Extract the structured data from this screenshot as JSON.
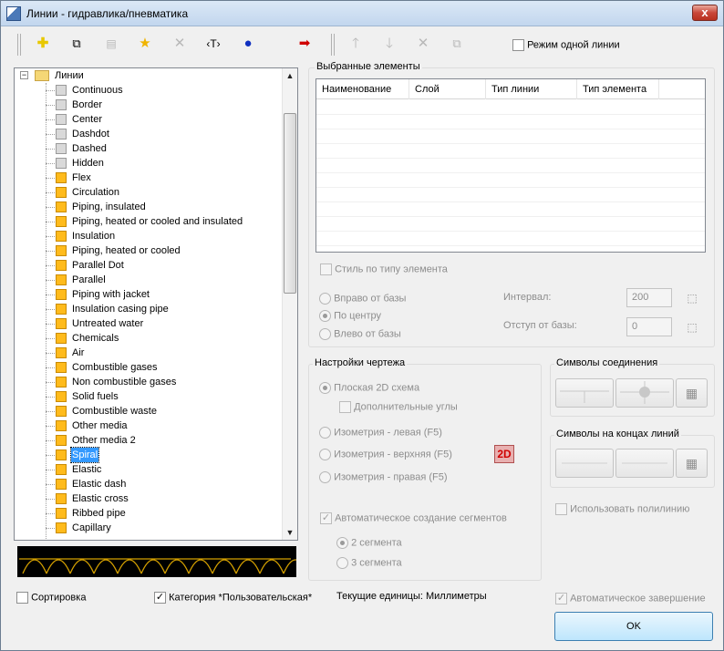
{
  "window": {
    "title": "Линии - гидравлика/пневматика",
    "close_label": "x"
  },
  "toolbar": {
    "mode_label": "Режим одной линии"
  },
  "tree": {
    "root": "Линии",
    "items": [
      {
        "label": "Continuous",
        "color": "gray"
      },
      {
        "label": "Border",
        "color": "gray"
      },
      {
        "label": "Center",
        "color": "gray"
      },
      {
        "label": "Dashdot",
        "color": "gray"
      },
      {
        "label": "Dashed",
        "color": "gray"
      },
      {
        "label": "Hidden",
        "color": "gray"
      },
      {
        "label": "Flex",
        "color": "orange"
      },
      {
        "label": "Circulation",
        "color": "orange"
      },
      {
        "label": "Piping, insulated",
        "color": "orange"
      },
      {
        "label": "Piping, heated or cooled and insulated",
        "color": "orange"
      },
      {
        "label": "Insulation",
        "color": "orange"
      },
      {
        "label": "Piping, heated or cooled",
        "color": "orange"
      },
      {
        "label": "Parallel Dot",
        "color": "orange"
      },
      {
        "label": "Parallel",
        "color": "orange"
      },
      {
        "label": "Piping with jacket",
        "color": "orange"
      },
      {
        "label": "Insulation casing pipe",
        "color": "orange"
      },
      {
        "label": "Untreated water",
        "color": "orange"
      },
      {
        "label": "Chemicals",
        "color": "orange"
      },
      {
        "label": "Air",
        "color": "orange"
      },
      {
        "label": "Combustible gases",
        "color": "orange"
      },
      {
        "label": "Non combustible gases",
        "color": "orange"
      },
      {
        "label": "Solid fuels",
        "color": "orange"
      },
      {
        "label": "Combustible waste",
        "color": "orange"
      },
      {
        "label": "Other media",
        "color": "orange"
      },
      {
        "label": "Other media 2",
        "color": "orange"
      },
      {
        "label": "Spiral",
        "color": "orange",
        "selected": true
      },
      {
        "label": "Elastic",
        "color": "orange"
      },
      {
        "label": "Elastic dash",
        "color": "orange"
      },
      {
        "label": "Elastic cross",
        "color": "orange"
      },
      {
        "label": "Ribbed pipe",
        "color": "orange"
      },
      {
        "label": "Capillary",
        "color": "orange"
      }
    ]
  },
  "selected_group": {
    "title": "Выбранные элементы",
    "columns": [
      "Наименование",
      "Слой",
      "Тип линии",
      "Тип элемента"
    ],
    "style_by_type": "Стиль по типу элемента",
    "align_right": "Вправо от базы",
    "align_center": "По центру",
    "align_left": "Влево от базы",
    "interval_label": "Интервал:",
    "interval_value": "200",
    "offset_label": "Отступ от базы:",
    "offset_value": "0"
  },
  "drawing": {
    "title": "Настройки чертежа",
    "flat": "Плоская 2D схема",
    "extra_angles": "Дополнительные углы",
    "iso_left": "Изометрия - левая (F5)",
    "iso_top": "Изометрия - верхняя (F5)",
    "iso_right": "Изометрия - правая (F5)",
    "badge": "2D",
    "auto_segments": "Автоматическое создание сегментов",
    "seg2": "2 сегмента",
    "seg3": "3 сегмента"
  },
  "connection": {
    "title": "Символы соединения"
  },
  "line_ends": {
    "title": "Символы на концах линий"
  },
  "use_polyline": "Использовать полилинию",
  "bottom": {
    "sort": "Сортировка",
    "category": "Категория *Пользовательская*",
    "units": "Текущие единицы: Миллиметры",
    "auto_finish": "Автоматическое завершение",
    "ok": "OK"
  },
  "colors": {
    "selection": "#3399ff",
    "folder_square": "#ffbb1c"
  }
}
